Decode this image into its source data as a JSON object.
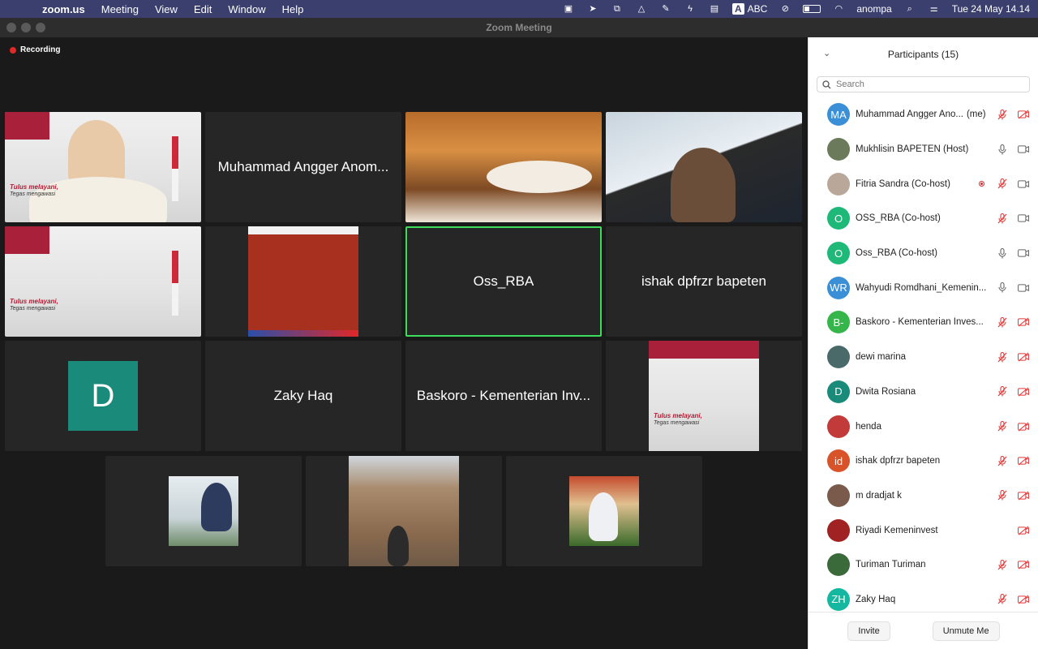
{
  "menubar": {
    "app": "zoom.us",
    "items": [
      "Meeting",
      "View",
      "Edit",
      "Window",
      "Help"
    ],
    "input_source": "ABC",
    "user": "anompa",
    "clock": "Tue 24 May  14.14"
  },
  "window": {
    "title": "Zoom Meeting"
  },
  "meeting": {
    "recording_label": "Recording",
    "tiles": {
      "t2_name": "Muhammad Angger Anom...",
      "t7_name": "Oss_RBA",
      "t8_name": "ishak dpfrzr bapeten",
      "t9_initial": "D",
      "t10_name": "Zaky Haq",
      "t11_name": "Baskoro - Kementerian Inv..."
    },
    "banner_text": "Tulus melayani,",
    "banner_text2": "Tegas mengawasi"
  },
  "panel": {
    "title": "Participants (15)",
    "search_placeholder": "Search",
    "participants": [
      {
        "name": "Muhammad Angger Ano...",
        "suffix": "(me)",
        "initials": "MA",
        "color": "#3a8fd6",
        "mic": "muted",
        "video": "off"
      },
      {
        "name": "Mukhlisin BAPETEN (Host)",
        "initials": "",
        "color": "#6b7a5a",
        "mic": "on",
        "video": "on"
      },
      {
        "name": "Fitria Sandra (Co-host)",
        "initials": "",
        "color": "#b9a89a",
        "mic": "muted",
        "video": "on",
        "recording": true
      },
      {
        "name": "OSS_RBA (Co-host)",
        "initials": "O",
        "color": "#1eb878",
        "mic": "muted",
        "video": "on"
      },
      {
        "name": "Oss_RBA (Co-host)",
        "initials": "O",
        "color": "#1eb878",
        "mic": "on",
        "video": "on"
      },
      {
        "name": "Wahyudi Romdhani_Kemenin...",
        "initials": "WR",
        "color": "#3a8fd6",
        "mic": "on",
        "video": "on"
      },
      {
        "name": "Baskoro - Kementerian Inves...",
        "initials": "B-",
        "color": "#36b64a",
        "mic": "muted",
        "video": "off"
      },
      {
        "name": "dewi marina",
        "initials": "",
        "color": "#4a6a6a",
        "mic": "muted",
        "video": "off"
      },
      {
        "name": "Dwita Rosiana",
        "initials": "D",
        "color": "#1a8a7a",
        "mic": "muted",
        "video": "off"
      },
      {
        "name": "henda",
        "initials": "",
        "color": "#c23a3a",
        "mic": "muted",
        "video": "off"
      },
      {
        "name": "ishak dpfrzr bapeten",
        "initials": "id",
        "color": "#d9532a",
        "mic": "muted",
        "video": "off"
      },
      {
        "name": "m dradjat k",
        "initials": "",
        "color": "#7a5a4a",
        "mic": "muted",
        "video": "off"
      },
      {
        "name": "Riyadi Kemeninvest",
        "initials": "",
        "color": "#a02222",
        "mic": "none",
        "video": "off"
      },
      {
        "name": "Turiman Turiman",
        "initials": "",
        "color": "#3a6a3a",
        "mic": "muted",
        "video": "off"
      },
      {
        "name": "Zaky Haq",
        "initials": "ZH",
        "color": "#14b8a0",
        "mic": "muted",
        "video": "off"
      }
    ],
    "invite_label": "Invite",
    "unmute_label": "Unmute Me"
  }
}
